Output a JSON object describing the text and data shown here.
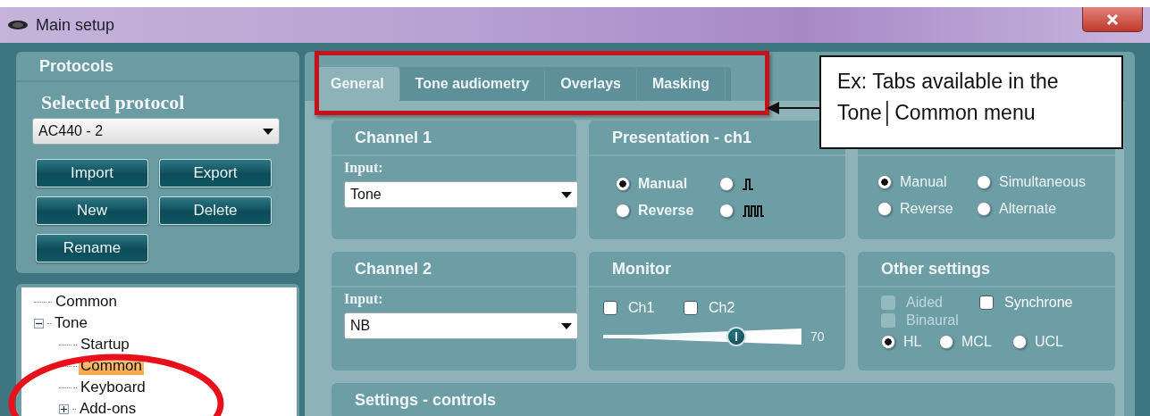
{
  "window": {
    "title": "Main setup"
  },
  "protocols": {
    "title": "Protocols",
    "selected_label": "Selected protocol",
    "selected_value": "AC440 - 2",
    "buttons": [
      "Import",
      "Export",
      "New",
      "Delete",
      "Rename"
    ]
  },
  "tree": [
    {
      "label": "Common",
      "selected": false
    },
    {
      "label": "Tone",
      "selected": false,
      "expanded": true,
      "children": [
        {
          "label": "Startup",
          "selected": false
        },
        {
          "label": "Common",
          "selected": true
        },
        {
          "label": "Keyboard",
          "selected": false
        },
        {
          "label": "Add-ons",
          "selected": false,
          "expanded": false
        }
      ]
    }
  ],
  "tabs": [
    {
      "label": "General",
      "selected": true
    },
    {
      "label": "Tone audiometry",
      "selected": false
    },
    {
      "label": "Overlays",
      "selected": false
    },
    {
      "label": "Masking",
      "selected": false
    }
  ],
  "channel_1": {
    "title": "Channel 1",
    "input_label": "Input:",
    "value": "Tone"
  },
  "presentation_ch1": {
    "title": "Presentation - ch1",
    "options": [
      {
        "kind": "text",
        "label": "Manual",
        "selected": true
      },
      {
        "kind": "single-pulse",
        "selected": false
      },
      {
        "kind": "text",
        "label": "Reverse",
        "selected": false
      },
      {
        "kind": "pulse-train",
        "selected": false
      }
    ]
  },
  "right_top_panel": {
    "options": [
      {
        "label": "Manual",
        "selected": true
      },
      {
        "label": "Simultaneous",
        "selected": false
      },
      {
        "label": "Reverse",
        "selected": false
      },
      {
        "label": "Alternate",
        "selected": false
      }
    ]
  },
  "channel_2": {
    "title": "Channel 2",
    "input_label": "Input:",
    "value": "NB"
  },
  "monitor": {
    "title": "Monitor",
    "checks": [
      {
        "label": "Ch1",
        "checked": false
      },
      {
        "label": "Ch2",
        "checked": false
      }
    ],
    "level": 0.67,
    "reading": "70"
  },
  "other_settings": {
    "title": "Other settings",
    "checks": [
      {
        "label": "Aided",
        "checked": false,
        "disabled": true
      },
      {
        "label": "Synchrone",
        "checked": false,
        "disabled": false
      },
      {
        "label": "Binaural",
        "checked": false,
        "disabled": true
      }
    ],
    "units": [
      {
        "label": "HL",
        "selected": true
      },
      {
        "label": "MCL",
        "selected": false
      },
      {
        "label": "UCL",
        "selected": false
      }
    ]
  },
  "settings_controls": {
    "title": "Settings - controls"
  },
  "callout": {
    "lines": [
      "Ex:  Tabs available in the",
      "Tone│Common menu"
    ]
  }
}
